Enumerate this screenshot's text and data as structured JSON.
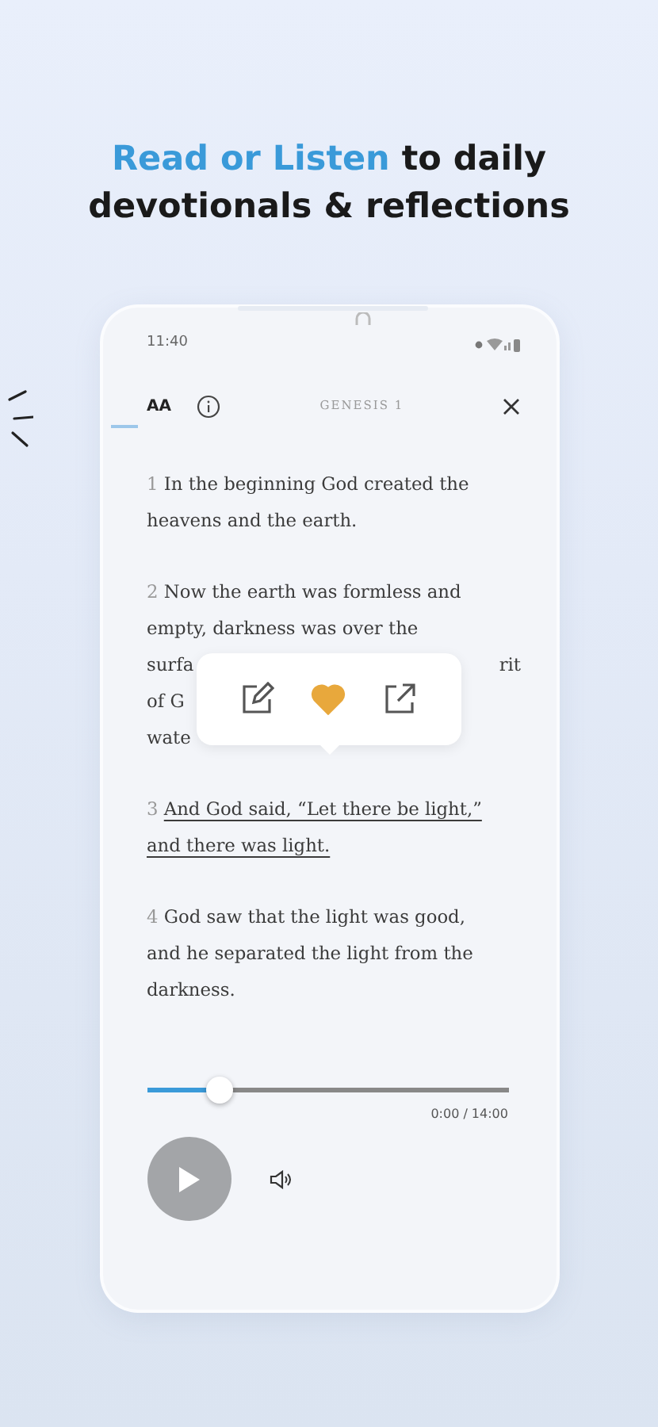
{
  "headline": [
    {
      "text": "Read or Listen",
      "accent": true
    },
    {
      "text": " to daily",
      "accent": false
    }
  ],
  "headline_line2": "devotionals & reflections",
  "status_bar": {
    "time": "11:40"
  },
  "toolbar": {
    "font_button": "AA",
    "title": "GENESIS 1"
  },
  "verses": [
    {
      "number": "1",
      "lines": [
        {
          "left": "In the beginning God created the"
        },
        {
          "left": "heavens and the earth."
        }
      ],
      "underlined": false
    },
    {
      "number": "2",
      "lines": [
        {
          "left": "Now the earth was formless and"
        },
        {
          "left": "empty, darkness was over the"
        },
        {
          "left": "surfa",
          "right": "rit"
        },
        {
          "left": "of G"
        },
        {
          "left": "wate"
        }
      ],
      "underlined": false
    },
    {
      "number": "3",
      "lines": [
        {
          "left": "And God said, “Let there be light,”"
        },
        {
          "left": "and there was light."
        }
      ],
      "underlined": true
    },
    {
      "number": "4",
      "lines": [
        {
          "left": "God saw that the light was good,"
        },
        {
          "left": "and he separated the light from the"
        },
        {
          "left": "darkness."
        }
      ],
      "underlined": false
    }
  ],
  "popup": {
    "favorited": true
  },
  "player": {
    "level": 0.2,
    "time": "0:00 / 14:00"
  }
}
